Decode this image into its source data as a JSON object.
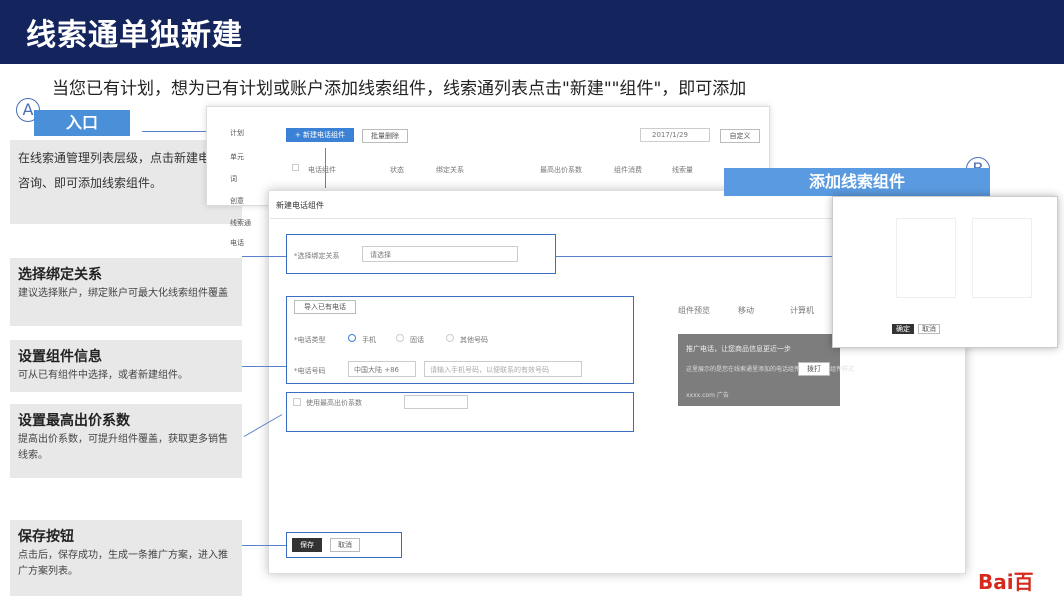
{
  "header": {
    "title": "线索通单独新建"
  },
  "intro": "当您已有计划，想为已有计划或账户添加线索组件，线索通列表点击\"新建\"\"组件\"，即可添加",
  "markers": {
    "a": "A",
    "b": "B"
  },
  "entry_tag": "入口",
  "entry_desc": "在线索通管理列表层级，点击新建电话、咨询、即可添加线索组件。",
  "add_tag": "添加线索组件",
  "steps": [
    {
      "title": "选择绑定关系",
      "desc": "建议选择账户，绑定账户可最大化线索组件覆盖"
    },
    {
      "title": "设置组件信息",
      "desc": "可从已有组件中选择，或者新建组件。"
    },
    {
      "title": "设置最高出价系数",
      "desc": "提高出价系数，可提升组件覆盖，获取更多销售线索。"
    },
    {
      "title": "保存按钮",
      "desc": "点击后，保存成功，生成一条推广方案，进入推广方案列表。"
    }
  ],
  "back_shot": {
    "nav": [
      "计划",
      "单元",
      "词",
      "创意",
      "线索通",
      "电话"
    ],
    "new_btn": "+ 新建电话组件",
    "batch_btn": "批量删除",
    "date": "2017/1/29",
    "custom_btn": "自定义",
    "cols": [
      "电话组件",
      "状态",
      "绑定关系",
      "最高出价系数",
      "组件消费",
      "线索量"
    ]
  },
  "main_shot": {
    "title": "新建电话组件",
    "bind_label": "*选择绑定关系",
    "bind_value": "请选择",
    "import_btn": "导入已有电话",
    "type_label": "*电话类型",
    "type_opts": [
      "手机",
      "固话",
      "其他号码"
    ],
    "num_label": "*电话号码",
    "region": "中国大陆 +86",
    "num_placeholder": "请输入手机号码，以便联系的有效号码",
    "coef_label": "使用最高出价系数",
    "preview_label": "组件预览",
    "preview_tabs": [
      "移动",
      "计算机"
    ],
    "card_title": "推广电话，让您商品信息更近一步",
    "card_body": "这里展示的是您在线索通里添加的电话组件的推广电话组件样式",
    "card_btn": "拨打",
    "card_foot": "xxxx.com 广告",
    "save_btn": "保存",
    "cancel_btn": "取消"
  },
  "popup": {
    "save_btn": "确定",
    "cancel_btn": "取消"
  },
  "logo": "Bai百"
}
